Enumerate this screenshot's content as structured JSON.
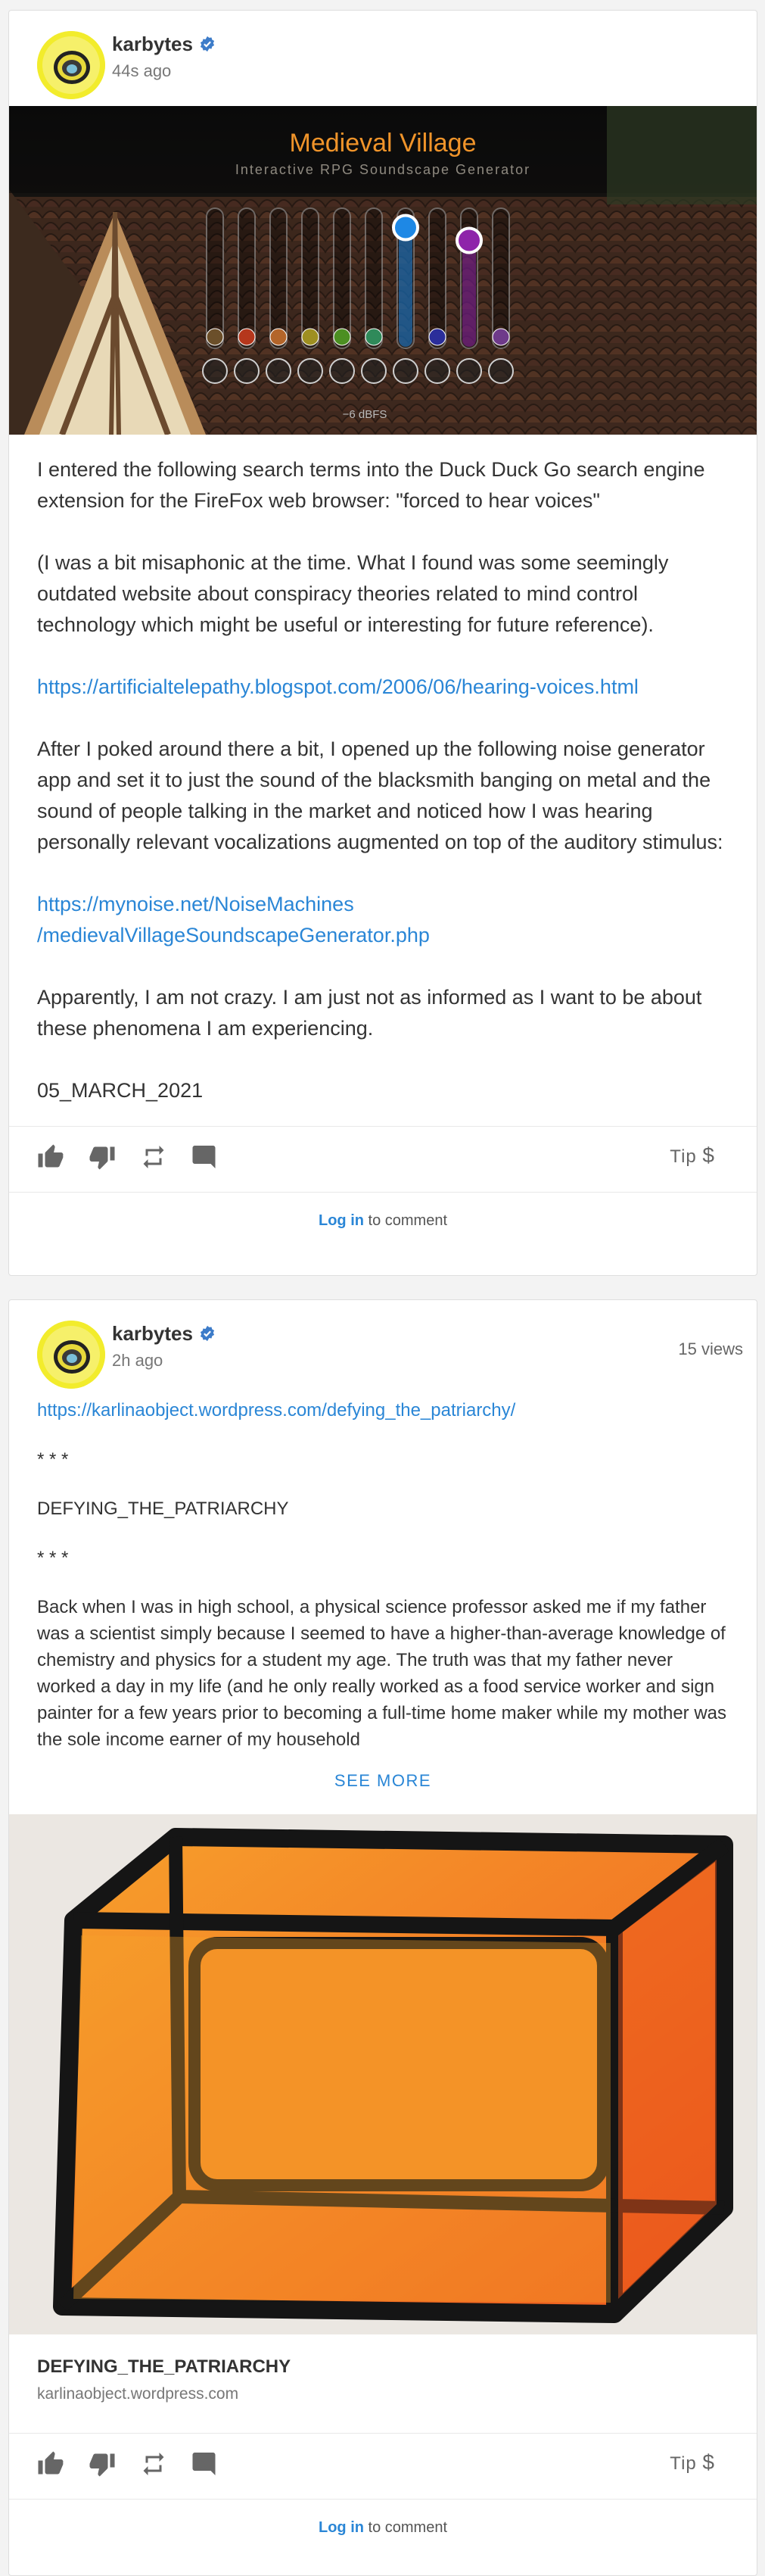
{
  "posts": [
    {
      "author": "karbytes",
      "time": "44s ago",
      "media": {
        "title": "Medieval Village",
        "subtitle": "Interactive RPG Soundscape Generator",
        "level_label": "−6 dBFS",
        "slider_levels": [
          0.0,
          0.0,
          0.0,
          0.0,
          0.0,
          0.0,
          0.85,
          0.0,
          0.75,
          0.0
        ]
      },
      "paragraphs": [
        "I entered the following search terms into the Duck Duck Go search engine extension for the FireFox web browser: \"forced to hear voices\"",
        "(I was a bit misaphonic at the time. What I found was some seemingly outdated website about conspiracy theories related to mind control technology which might be useful or interesting for future reference).",
        "https://artificialtelepathy.blogspot.com/2006/06/hearing-voices.html",
        "After I poked around there a bit, I opened up the following noise generator app and set it to just the sound of the blacksmith banging on metal and the sound of people talking in the market and noticed how I was hearing personally relevant vocalizations augmented on top of the auditory stimulus:",
        "https://mynoise.net/NoiseMachines\n/medievalVillageSoundscapeGenerator.php",
        "Apparently, I am not crazy. I am just not as informed as I want to be about these phenomena I am experiencing.",
        "05_MARCH_2021"
      ],
      "tip_label": "Tip",
      "login_label": "Log in",
      "comment_suffix": " to comment"
    },
    {
      "author": "karbytes",
      "time": "2h ago",
      "views": "15 views",
      "link": "https://karlinaobject.wordpress.com/defying_the_patriarchy/",
      "paragraphs": [
        "* * *",
        "DEFYING_THE_PATRIARCHY",
        "* * *",
        "Back when I was in high school, a physical science professor asked me if my father was a scientist simply because I seemed to have a higher-than-average knowledge of chemistry and physics for a student my age. The truth was that my father never worked a day in my life (and he only really worked as a food service worker and sign painter for a few years prior to becoming a full-time home maker while my mother was the sole income earner of my household"
      ],
      "see_more": "SEE MORE",
      "preview_title": "DEFYING_THE_PATRIARCHY",
      "preview_domain": "karlinaobject.wordpress.com",
      "tip_label": "Tip",
      "login_label": "Log in",
      "comment_suffix": " to comment"
    }
  ],
  "colors": {
    "link": "#2a86d6",
    "verified": "#3d7cc9",
    "slider_blue": "#1e88e5",
    "slider_purple": "#8e24aa"
  },
  "icons": [
    "verified-badge-icon",
    "thumbs-up-icon",
    "thumbs-down-icon",
    "repost-icon",
    "comment-icon",
    "dollar-icon"
  ]
}
